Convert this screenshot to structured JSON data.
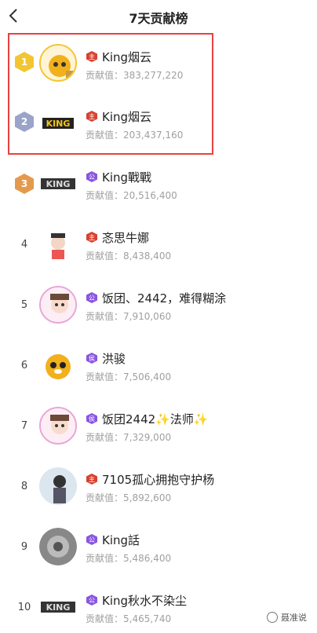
{
  "header": {
    "title": "7天贡献榜"
  },
  "contrib_label": "贡献值：",
  "rows": [
    {
      "rank": "1",
      "name": "King烟云",
      "badge": "主",
      "badge_color": "red",
      "value": "383,277,220"
    },
    {
      "rank": "2",
      "name": "King烟云",
      "badge": "主",
      "badge_color": "red",
      "value": "203,437,160"
    },
    {
      "rank": "3",
      "name": "King戰戰",
      "badge": "公",
      "badge_color": "purple",
      "value": "20,516,400"
    },
    {
      "rank": "4",
      "name": "忞思牛娜",
      "badge": "主",
      "badge_color": "red",
      "value": "8,438,400"
    },
    {
      "rank": "5",
      "name": "饭团、2442，难得糊涂",
      "badge": "公",
      "badge_color": "purple",
      "value": "7,910,060"
    },
    {
      "rank": "6",
      "name": "洪骏",
      "badge": "侯",
      "badge_color": "purple",
      "value": "7,506,400"
    },
    {
      "rank": "7",
      "name": "饭团2442✨法师✨",
      "badge": "侯",
      "badge_color": "purple",
      "value": "7,329,000"
    },
    {
      "rank": "8",
      "name": "7105孤心拥抱守护杨",
      "badge": "主",
      "badge_color": "red",
      "value": "5,892,600"
    },
    {
      "rank": "9",
      "name": "King話",
      "badge": "公",
      "badge_color": "purple",
      "value": "5,486,400"
    },
    {
      "rank": "10",
      "name": "King秋水不染尘",
      "badge": "公",
      "badge_color": "purple",
      "value": "5,465,740"
    }
  ],
  "watermark": "聂准说",
  "colors": {
    "highlight": "#e8423f",
    "gold": "#f3c531",
    "silver": "#9aa3c8",
    "bronze": "#e49a4e"
  }
}
